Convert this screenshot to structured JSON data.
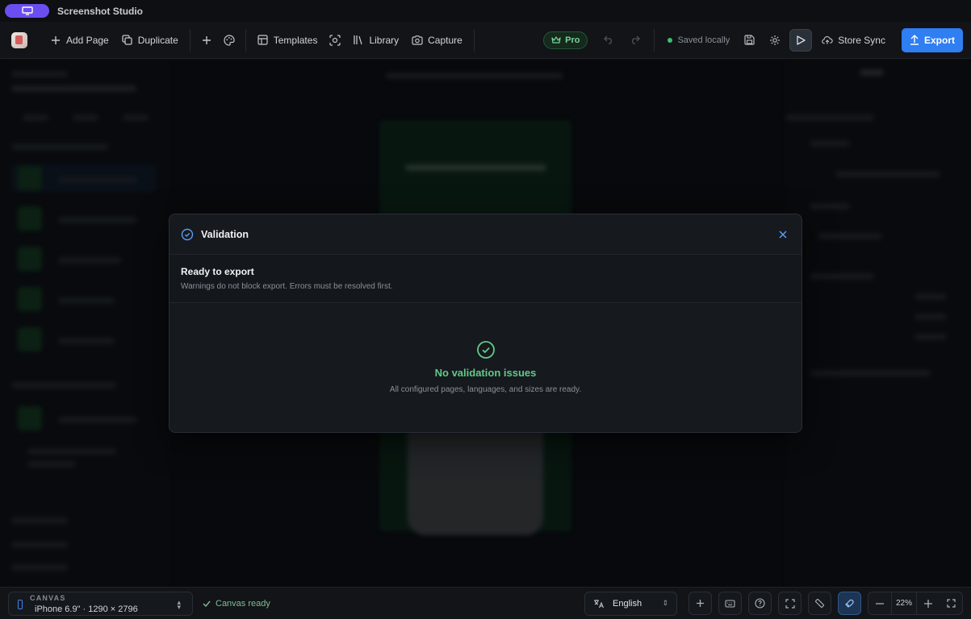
{
  "app": {
    "title": "Screenshot Studio"
  },
  "toolbar": {
    "add_page": "Add Page",
    "duplicate": "Duplicate",
    "templates": "Templates",
    "library": "Library",
    "capture": "Capture",
    "pro": "Pro",
    "saved_status": "Saved locally",
    "store_sync": "Store Sync",
    "export": "Export"
  },
  "modal": {
    "title": "Validation",
    "summary_title": "Ready to export",
    "summary_text": "Warnings do not block export. Errors must be resolved first.",
    "result_title": "No validation issues",
    "result_text": "All configured pages, languages, and sizes are ready."
  },
  "statusbar": {
    "canvas_label": "CANVAS",
    "canvas_value": "iPhone 6.9\" · 1290 × 2796",
    "canvas_status": "Canvas ready",
    "language": "English",
    "zoom": "22%"
  },
  "colors": {
    "accent": "#2f7ef2",
    "success": "#62c98a",
    "brand": "#6b4ef0"
  }
}
